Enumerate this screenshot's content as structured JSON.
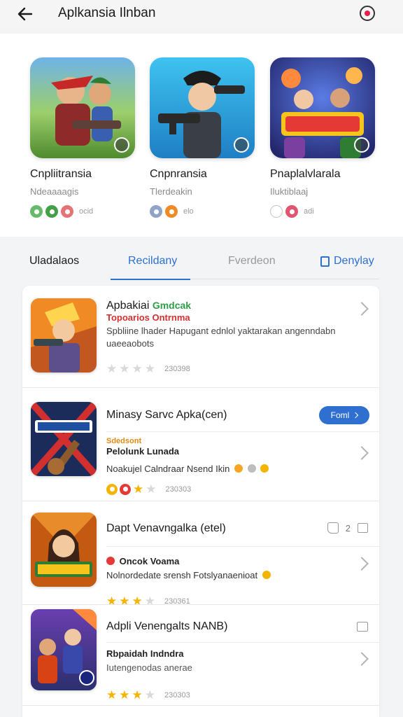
{
  "header": {
    "title": "Aplkansia Ilnban",
    "back_icon": "arrow-left-icon",
    "action_icon": "record-icon"
  },
  "featured": [
    {
      "name": "Cnpliitransia",
      "sub": "Ndeaaaagis",
      "meta": "ocid",
      "meta_colors": [
        "#66bb6a",
        "#43a047",
        "#e57373"
      ]
    },
    {
      "name": "Cnpnransia",
      "sub": "Tlerdeakin",
      "meta": "elo",
      "meta_colors": [
        "#90a4c8",
        "#f08a24"
      ]
    },
    {
      "name": "Pnaplalvlarala",
      "sub": "Iluktiblaaj",
      "meta": "adi",
      "meta_colors": [
        "#c7c7c7",
        "#e0566e"
      ]
    }
  ],
  "tabs": {
    "items": [
      "Uladalaos",
      "Recildany",
      "Fverdeon",
      "Denylay"
    ],
    "active": 1
  },
  "list": [
    {
      "title": "Apbakiai",
      "title_accent": "Gmdcak",
      "tag": "Topoarios Ontrnma",
      "desc": "Spbliine lhader Hapugant ednlol yaktarakan angenndabn uaeeaobots",
      "stars": 0,
      "rating": "230398"
    },
    {
      "title": "Minasy Sarvc Apka(cen)",
      "button": "Foml",
      "tag": "Sdedsont",
      "line1": "Pelolunk Lunada",
      "line2": "Noakujel Calndraar Nsend Ikin",
      "stars": 1,
      "rating": "230303"
    },
    {
      "title": "Dapt Venavngalka (etel)",
      "likes": "2",
      "line1": "Oncok Voama",
      "line2": "Nolnordedate srensh Fotslyanaenioat",
      "stars": 3,
      "rating": "230361"
    },
    {
      "title": "Adpli Venengalts NANB)",
      "line1": "Rbpaidah Indndra",
      "line2": "Iutengenodas anerae",
      "stars": 3,
      "rating": "230303"
    }
  ],
  "colors": {
    "accent": "#2f6fd0",
    "star": "#f5b400",
    "tag_red": "#d32f2f",
    "title_green": "#2e9e44"
  }
}
